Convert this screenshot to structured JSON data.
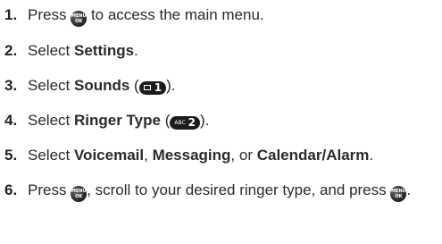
{
  "steps": [
    {
      "num": "1.",
      "pre": "Press",
      "post": "to access the main menu."
    },
    {
      "num": "2.",
      "pre": "Select ",
      "bold": "Settings",
      "post": "."
    },
    {
      "num": "3.",
      "pre": "Select ",
      "bold": "Sounds",
      "open": " (",
      "key_digit": "1",
      "close": ")."
    },
    {
      "num": "4.",
      "pre": "Select ",
      "bold": "Ringer Type",
      "open": " (",
      "key_sub": "ABC",
      "key_digit": "2",
      "close": ")."
    },
    {
      "num": "5.",
      "pre": "Select ",
      "b1": "Voicemail",
      "sep1": ", ",
      "b2": "Messaging",
      "sep2": ", or ",
      "b3": "Calendar/Alarm",
      "post": "."
    },
    {
      "num": "6.",
      "pre": "Press",
      "mid": ", scroll to your desired ringer type, and press",
      "post": "."
    }
  ],
  "menu_button": {
    "line1": "MENU",
    "line2": "OK"
  },
  "icons": {
    "menu_ok": "menu-ok-button-icon",
    "envelope": "envelope-icon"
  }
}
